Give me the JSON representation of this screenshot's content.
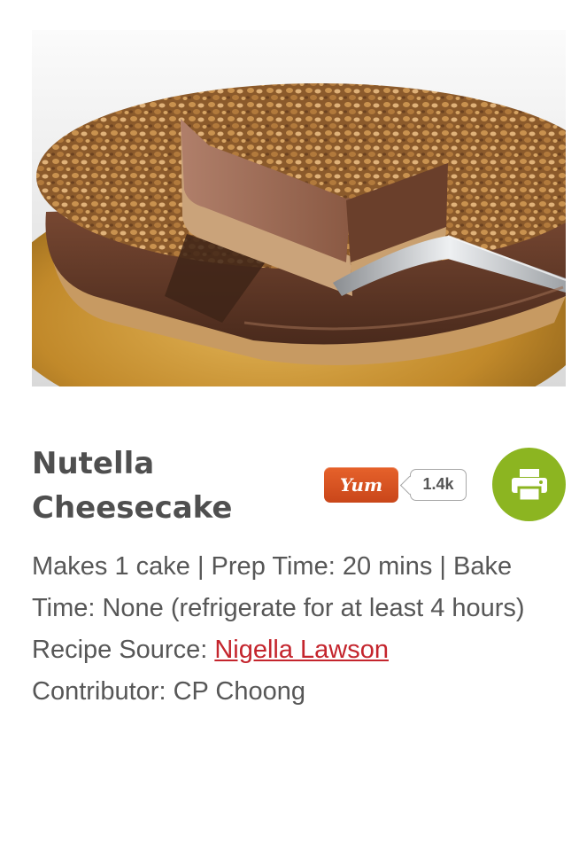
{
  "hero": {
    "image_subject": "nutella-cheesecake-photo"
  },
  "recipe": {
    "title": "Nutella Cheesecake",
    "yield_time_line": "Makes 1 cake | Prep Time: 20 mins | Bake Time: None (refrigerate for at least 4 hours)",
    "source_label": "Recipe Source: ",
    "source_link": "Nigella Lawson",
    "contributor_line": "Contributor: CP Choong"
  },
  "actions": {
    "yum_label": "Yum",
    "yum_count": "1.4k",
    "print_icon": "printer-icon"
  },
  "colors": {
    "title": "#4f4f4f",
    "body_text": "#575757",
    "link": "#c4252d",
    "yum_button": "#d6521f",
    "print_button": "#8cb521"
  }
}
